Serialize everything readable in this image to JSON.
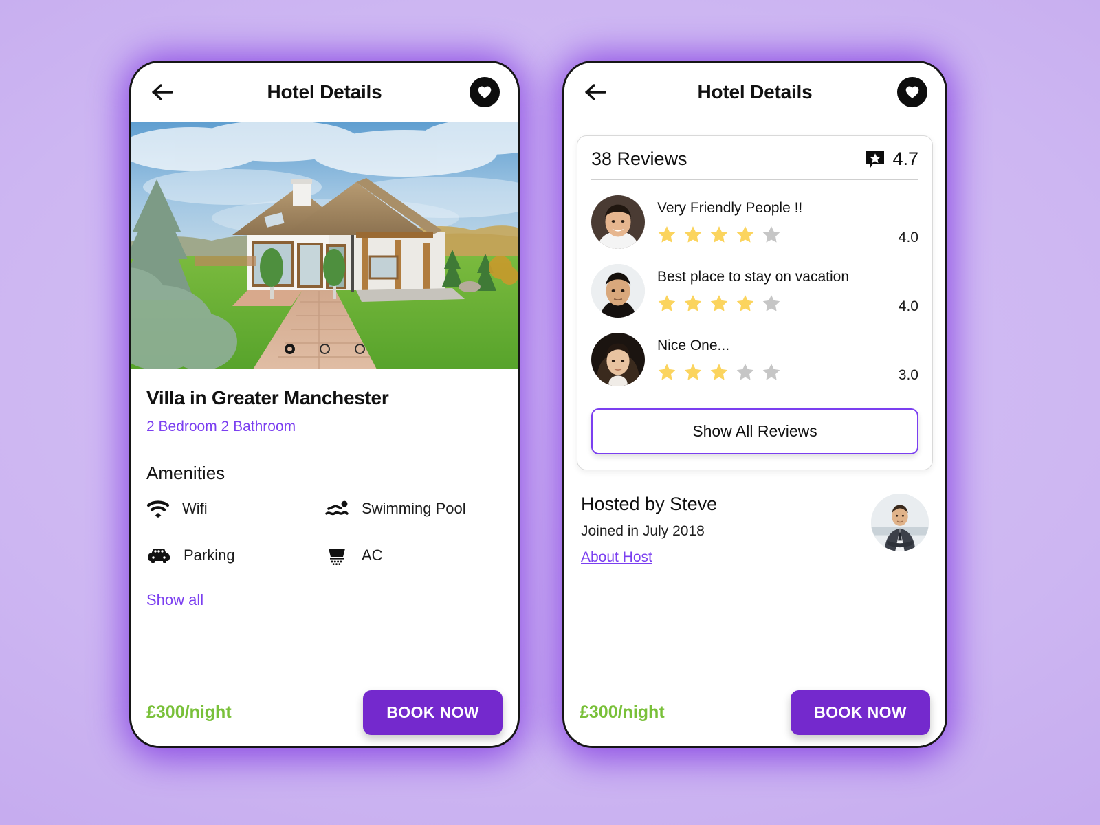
{
  "theme": {
    "background_lavender": "#cdb6f2",
    "glow_purple": "#7b2fe0",
    "accent_purple": "#7b3ff0",
    "button_purple": "#7429cd",
    "price_green": "#79c039",
    "star_gold": "#FBD45E",
    "star_gray": "#c6c6c6"
  },
  "screen_left": {
    "appbar": {
      "back_icon": "arrow-left-icon",
      "title": "Hotel Details",
      "favorite_icon": "heart-icon"
    },
    "gallery": {
      "dots": [
        "active",
        "inactive",
        "inactive"
      ],
      "image_alt": "villa-exterior-photo"
    },
    "property": {
      "title": "Villa in Greater Manchester",
      "subtitle": "2 Bedroom 2 Bathroom"
    },
    "amenities": {
      "heading": "Amenities",
      "items": [
        {
          "label": "Wifi",
          "icon": "wifi-icon"
        },
        {
          "label": "Swimming Pool",
          "icon": "swimmer-icon"
        },
        {
          "label": "Parking",
          "icon": "car-icon"
        },
        {
          "label": "AC",
          "icon": "air-conditioner-icon"
        }
      ],
      "show_all": "Show all"
    },
    "bottombar": {
      "price": "£300/night",
      "book_label": "BOOK NOW"
    }
  },
  "screen_right": {
    "appbar": {
      "back_icon": "arrow-left-icon",
      "title": "Hotel Details",
      "favorite_icon": "heart-icon"
    },
    "reviews": {
      "count_label": "38 Reviews",
      "rating_badge_icon": "star-bubble-icon",
      "rating_value": "4.7",
      "items": [
        {
          "text": "Very Friendly People !!",
          "stars_filled": 4,
          "stars_total": 5,
          "score": "4.0",
          "avatar": "avatar-man-smiling"
        },
        {
          "text": "Best place to stay on vacation",
          "stars_filled": 4,
          "stars_total": 5,
          "score": "4.0",
          "avatar": "avatar-man-turtleneck"
        },
        {
          "text": "Nice One...",
          "stars_filled": 3,
          "stars_total": 5,
          "score": "3.0",
          "avatar": "avatar-woman-long-hair"
        }
      ],
      "show_all_label": "Show All Reviews"
    },
    "host": {
      "name": "Hosted by Steve",
      "joined": "Joined in July 2018",
      "link": "About Host",
      "avatar": "avatar-host-suit"
    },
    "bottombar": {
      "price": "£300/night",
      "book_label": "BOOK NOW"
    }
  }
}
